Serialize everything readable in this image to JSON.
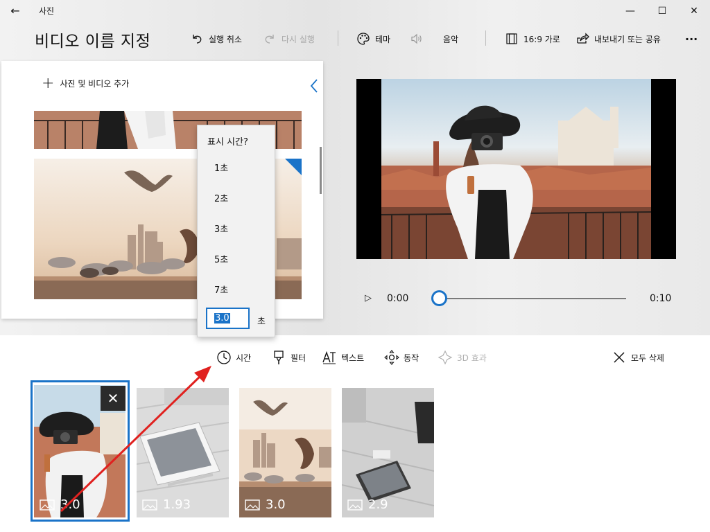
{
  "window": {
    "app_title": "사진",
    "back_glyph": "←",
    "minimize_glyph": "—",
    "maximize_glyph": "☐",
    "close_glyph": "✕"
  },
  "header": {
    "project_title": "비디오 이름 지정",
    "undo_label": "실행 취소",
    "redo_label": "다시 실행",
    "theme_label": "테마",
    "music_label": "음악",
    "aspect_label": "16:9 가로",
    "export_label": "내보내기 또는 공유",
    "more_glyph": "···"
  },
  "library": {
    "add_label": "사진 및 비디오 추가",
    "collapse_glyph": "〈"
  },
  "duration_flyout": {
    "title": "표시 시간?",
    "options": [
      "1초",
      "2초",
      "3초",
      "5초",
      "7초"
    ],
    "input_value": "3.0",
    "unit": "초"
  },
  "player": {
    "play_glyph": "▷",
    "current_time": "0:00",
    "total_time": "0:10",
    "progress": 0
  },
  "storyboard_toolbar": {
    "duration_label": "시간",
    "filters_label": "필터",
    "text_label": "텍스트",
    "motion_label": "동작",
    "effects_3d_label": "3D 효과",
    "remove_all_label": "모두 삭제"
  },
  "storyboard": {
    "remove_glyph": "✕",
    "cards": [
      {
        "duration": "3.0"
      },
      {
        "duration": "1.93"
      },
      {
        "duration": "3.0"
      },
      {
        "duration": "2.9"
      }
    ]
  },
  "colors": {
    "accent": "#1a73c8",
    "annotation_arrow": "#e0211f"
  }
}
